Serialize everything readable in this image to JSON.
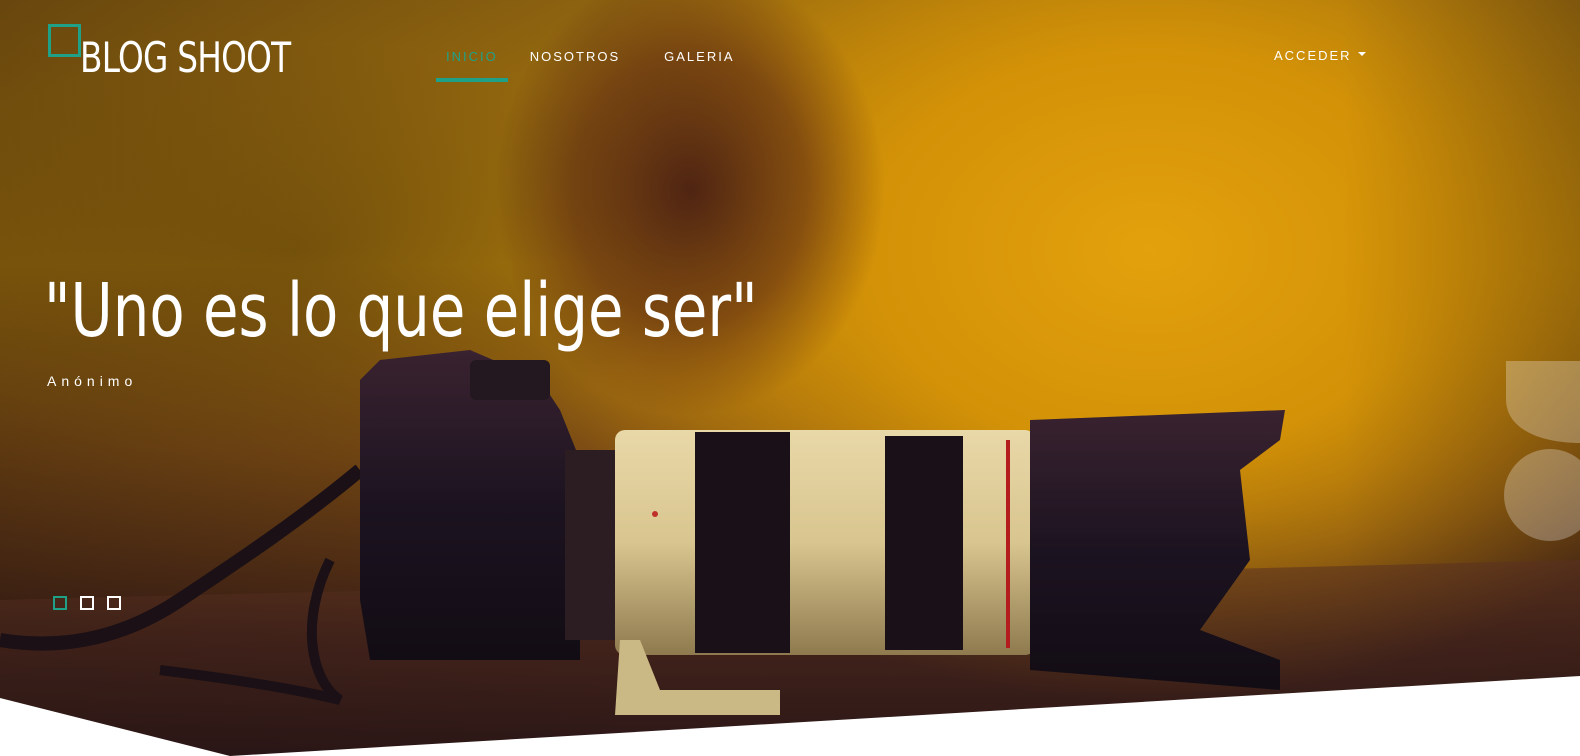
{
  "brand": {
    "name": "BLOG SHOOT"
  },
  "nav": {
    "items": [
      {
        "label": "INICIO",
        "active": true
      },
      {
        "label": "NOSOTROS",
        "active": false
      },
      {
        "label": "GALERIA",
        "active": false
      }
    ],
    "login_label": "ACCEDER"
  },
  "hero": {
    "quote": "\"Uno es lo que elige ser\"",
    "author": "Anónimo",
    "slides": [
      {
        "active": true
      },
      {
        "active": false
      },
      {
        "active": false
      }
    ]
  },
  "colors": {
    "accent": "#1fa187",
    "text": "#ffffff"
  },
  "icons": {
    "login_caret": "caret-down-icon"
  }
}
